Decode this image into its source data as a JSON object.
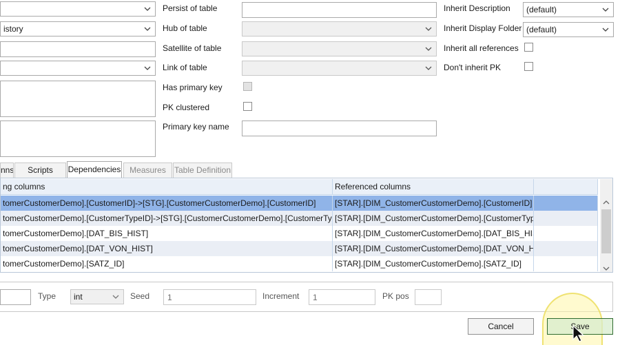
{
  "left_panel": {
    "field2_value": "istory"
  },
  "mid_panel": {
    "persist_label": "Persist of table",
    "hub_label": "Hub of table",
    "satellite_label": "Satellite of table",
    "link_label": "Link of table",
    "has_pk_label": "Has primary key",
    "pk_clustered_label": "PK clustered",
    "pk_name_label": "Primary key name"
  },
  "right_panel": {
    "inherit_desc_label": "Inherit Description",
    "inherit_desc_value": "(default)",
    "inherit_folder_label": "Inherit Display Folder",
    "inherit_folder_value": "(default)",
    "inherit_refs_label": "Inherit all references",
    "dont_inherit_pk_label": "Don't inherit PK"
  },
  "tabs": [
    {
      "label": "nns"
    },
    {
      "label": "Scripts"
    },
    {
      "label": "Dependencies"
    },
    {
      "label": "Measures"
    },
    {
      "label": "Table Definition"
    }
  ],
  "grid": {
    "col1_header": "ng columns",
    "col2_header": "Referenced columns",
    "rows": [
      {
        "col1": "tomerCustomerDemo].[CustomerID]->[STG].[CustomerCustomerDemo].[CustomerID]",
        "col2": "[STAR].[DIM_CustomerCustomerDemo].[CustomerID]"
      },
      {
        "col1": "tomerCustomerDemo].[CustomerTypeID]->[STG].[CustomerCustomerDemo].[CustomerTypeID]",
        "col2": "[STAR].[DIM_CustomerCustomerDemo].[CustomerTypeID]"
      },
      {
        "col1": "tomerCustomerDemo].[DAT_BIS_HIST]",
        "col2": "[STAR].[DIM_CustomerCustomerDemo].[DAT_BIS_HIST]"
      },
      {
        "col1": "tomerCustomerDemo].[DAT_VON_HIST]",
        "col2": "[STAR].[DIM_CustomerCustomerDemo].[DAT_VON_HIST]"
      },
      {
        "col1": "tomerCustomerDemo].[SATZ_ID]",
        "col2": "[STAR].[DIM_CustomerCustomerDemo].[SATZ_ID]"
      }
    ]
  },
  "identity": {
    "type_label": "Type",
    "type_value": "int",
    "seed_label": "Seed",
    "seed_value": "1",
    "increment_label": "Increment",
    "increment_value": "1",
    "pk_pos_label": "PK pos"
  },
  "footer": {
    "cancel_label": "Cancel",
    "save_label": "Save"
  },
  "colors": {
    "selected_row": "#90b4e8",
    "alt_row": "#eaeef5",
    "grid_border": "#c5d6ea",
    "cursor_highlight": "#fff6a8"
  }
}
